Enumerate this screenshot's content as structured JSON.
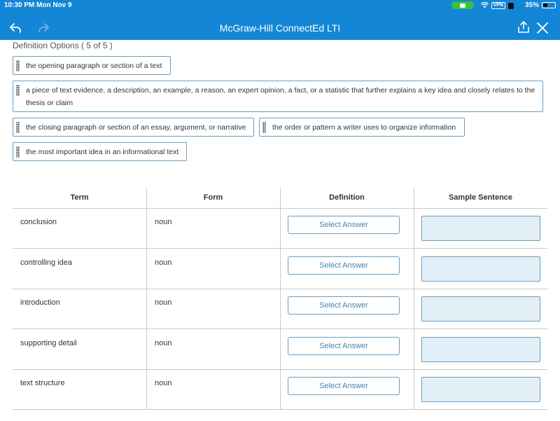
{
  "status_bar": {
    "time": "10:30 PM",
    "date": "Mon Nov 9",
    "vpn": "VPN",
    "battery": "35%",
    "battery_level": 0.35
  },
  "nav_bar": {
    "title": "McGraw-Hill ConnectEd LTI",
    "icons": [
      "back-icon",
      "forward-icon",
      "share-icon",
      "close-icon"
    ]
  },
  "options": {
    "title": "Definition Options ( 5 of 5 )",
    "items": [
      "the opening paragraph or section of a text",
      "a piece of text evidence, a description, an example, a reason, an expert opinion, a fact, or a statistic that further explains a key idea and closely relates to the thesis or claim",
      "the closing paragraph or section of an essay, argument, or narrative",
      "the order or pattern a writer uses to organize information",
      "the most important idea in an informational text"
    ]
  },
  "table": {
    "headers": [
      "Term",
      "Form",
      "Definition",
      "Sample Sentence"
    ],
    "rows": [
      {
        "term": "conclusion",
        "form": "noun",
        "definition": "Select Answer"
      },
      {
        "term": "controlling idea",
        "form": "noun",
        "definition": "Select Answer"
      },
      {
        "term": "introduction",
        "form": "noun",
        "definition": "Select Answer"
      },
      {
        "term": "supporting detail",
        "form": "noun",
        "definition": "Select Answer"
      },
      {
        "term": "text structure",
        "form": "noun",
        "definition": "Select Answer"
      }
    ]
  }
}
